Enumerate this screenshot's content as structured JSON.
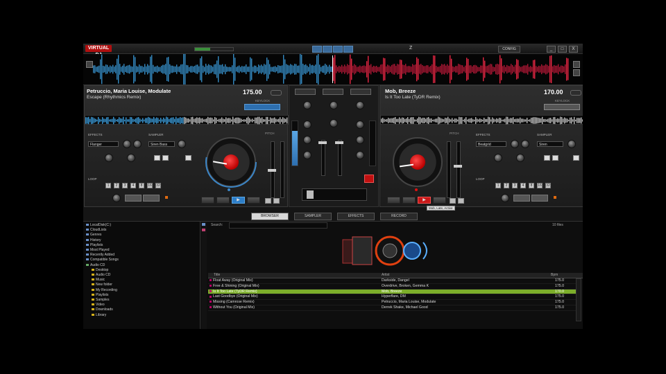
{
  "topbar": {
    "brand": "VIRTUAL DJ",
    "zoom": "Z",
    "config": "CONFIG",
    "min": "_",
    "max": "□",
    "close": "X"
  },
  "deck_left": {
    "artist": "Petruccio, Maria Louise, Modulate",
    "title": "Escape (Rhythmics Remix)",
    "bpm": "175.00",
    "keylock_label": "KEYLOCK",
    "effects_label": "EFFECTS",
    "effect_value": "Flanger",
    "sampler_label": "SAMPLER",
    "sampler_value": "Siren Bass",
    "loop_label": "LOOP",
    "loop_values": [
      "1",
      "2",
      "3",
      "4",
      "8",
      "16",
      "32"
    ],
    "play_symbol": "▶"
  },
  "deck_right": {
    "artist": "Mob, Breeze",
    "title": "Is It Too Late (TyDR Remix)",
    "bpm": "170.00",
    "keylock_label": "KEYLOCK",
    "effects_label": "EFFECTS",
    "effect_value": "Beatgrid",
    "sampler_label": "SAMPLER",
    "sampler_value": "Siren",
    "loop_label": "LOOP",
    "loop_values": [
      "1",
      "2",
      "3",
      "4",
      "8",
      "16",
      "32"
    ],
    "play_symbol": "▶",
    "tooltip": "Mob, Late, Active"
  },
  "tabs": [
    "BROWSER",
    "SAMPLER",
    "EFFECTS",
    "RECORD"
  ],
  "browser": {
    "search_label": "Search:",
    "count_label": "10 files",
    "tree": [
      {
        "label": "LocalDisk(C:)",
        "type": "b"
      },
      {
        "label": "CloudLists",
        "type": "b"
      },
      {
        "label": "Genres",
        "type": "b"
      },
      {
        "label": "History",
        "type": "b"
      },
      {
        "label": "Playlists",
        "type": "b"
      },
      {
        "label": "Most Played",
        "type": "b"
      },
      {
        "label": "Recently Added",
        "type": "b"
      },
      {
        "label": "Compatible Songs",
        "type": "b"
      },
      {
        "label": "Audio CD",
        "type": "g"
      },
      {
        "label": "Desktop",
        "type": "y"
      },
      {
        "label": "Audio CD",
        "type": "y"
      },
      {
        "label": "Music",
        "type": "y"
      },
      {
        "label": "New folder",
        "type": "y"
      },
      {
        "label": "My Recording",
        "type": "y"
      },
      {
        "label": "Playlists",
        "type": "y"
      },
      {
        "label": "Samples",
        "type": "y"
      },
      {
        "label": "Video",
        "type": "y"
      },
      {
        "label": "Downloads",
        "type": "y"
      },
      {
        "label": "Library",
        "type": "y"
      }
    ],
    "columns": [
      "Title",
      "Artist",
      "Bpm"
    ],
    "rows": [
      {
        "title": "Float Away (Original Mix)",
        "artist": "Darkside, Dangel",
        "bpm": "175.0",
        "selected": false
      },
      {
        "title": "Free & Shining (Original Mix)",
        "artist": "Overdrive, Broken, Gemma K",
        "bpm": "175.0",
        "selected": false
      },
      {
        "title": "Is It Too Late (TyDR Remix)",
        "artist": "Mob, Breeze",
        "bpm": "170.0",
        "selected": true
      },
      {
        "title": "Last Goodbye (Original Mix)",
        "artist": "Hyperflare, DM",
        "bpm": "175.0",
        "selected": false
      },
      {
        "title": "Missing (Camrose Remix)",
        "artist": "Petruccio, Maria Louise, Modulate",
        "bpm": "175.0",
        "selected": false
      },
      {
        "title": "Without You (Original Mix)",
        "artist": "Derrek Shake, Michael Good",
        "bpm": "175.0",
        "selected": false
      }
    ]
  },
  "colors": {
    "accent_blue": "#3a86c8",
    "accent_red": "#e01010",
    "selected_green": "#7cae2a"
  }
}
